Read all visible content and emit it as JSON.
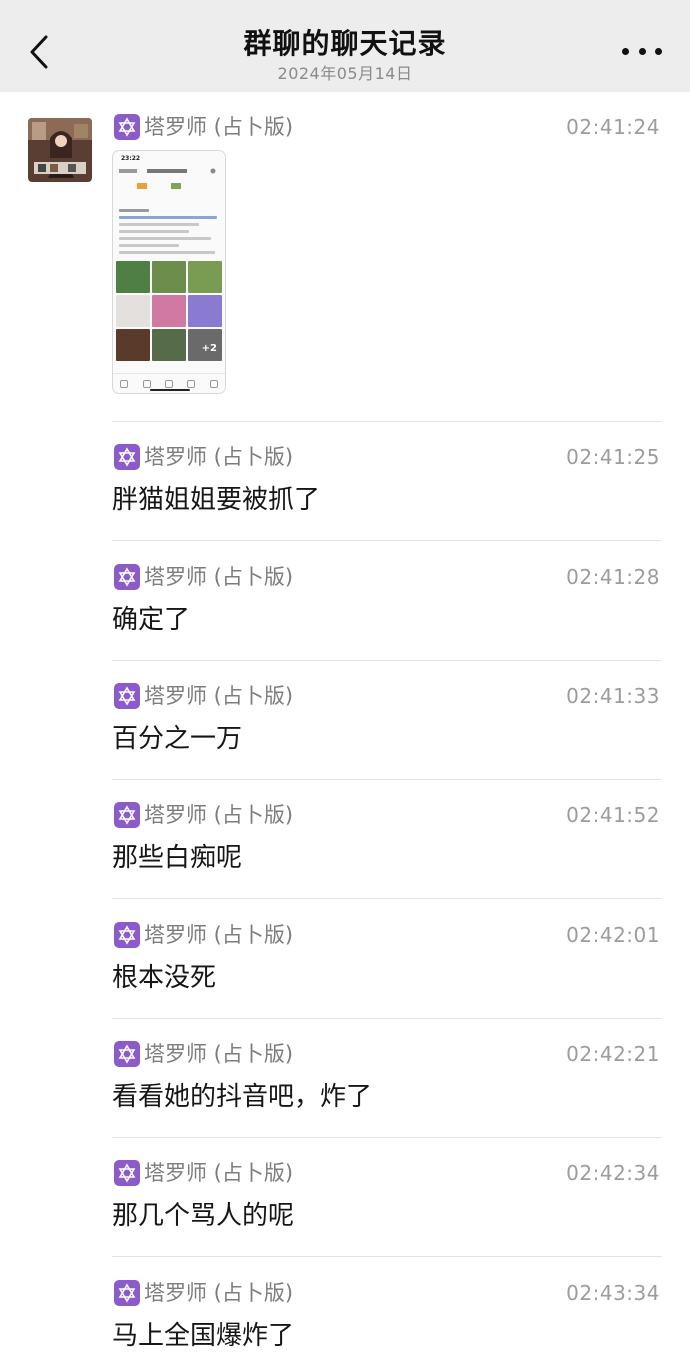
{
  "header": {
    "title": "群聊的聊天记录",
    "subtitle": "2024年05月14日",
    "back_icon": "chevron-left-icon",
    "more_icon": "more-dots-icon"
  },
  "sender_badge": {
    "icon": "hexagram-icon",
    "color": "#8a5bc9"
  },
  "messages": [
    {
      "sender": "塔罗师 (占卜版)",
      "time": "02:41:24",
      "type": "image"
    },
    {
      "sender": "塔罗师 (占卜版)",
      "time": "02:41:25",
      "text": "胖猫姐姐要被抓了"
    },
    {
      "sender": "塔罗师 (占卜版)",
      "time": "02:41:28",
      "text": "确定了"
    },
    {
      "sender": "塔罗师 (占卜版)",
      "time": "02:41:33",
      "text": "百分之一万"
    },
    {
      "sender": "塔罗师 (占卜版)",
      "time": "02:41:52",
      "text": "那些白痴呢"
    },
    {
      "sender": "塔罗师 (占卜版)",
      "time": "02:42:01",
      "text": "根本没死"
    },
    {
      "sender": "塔罗师 (占卜版)",
      "time": "02:42:21",
      "text": "看看她的抖音吧，炸了"
    },
    {
      "sender": "塔罗师 (占卜版)",
      "time": "02:42:34",
      "text": "那几个骂人的呢"
    },
    {
      "sender": "塔罗师 (占卜版)",
      "time": "02:43:34",
      "text": "马上全国爆炸了"
    }
  ],
  "thumbnail": {
    "status_time": "23:22",
    "plus_count": "+2"
  }
}
